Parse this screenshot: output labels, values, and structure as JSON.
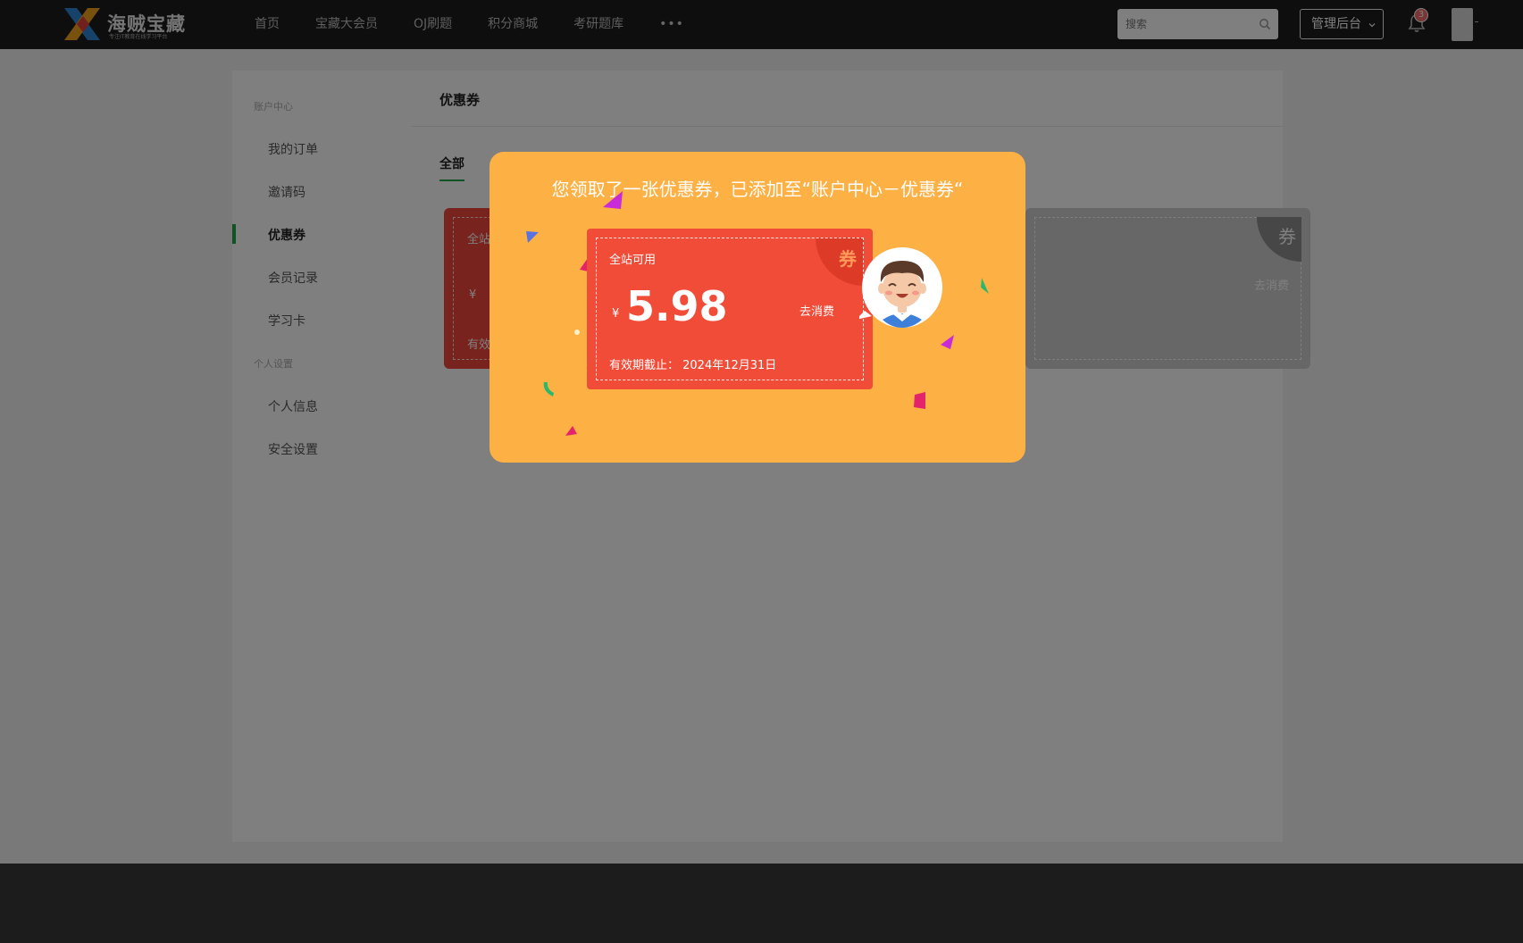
{
  "header": {
    "logo_title": "海贼宝藏",
    "logo_subtitle": "专注IT教育在线学习平台",
    "nav": [
      "首页",
      "宝藏大会员",
      "OJ刷题",
      "积分商城",
      "考研题库"
    ],
    "nav_more": "•••",
    "search_placeholder": "搜索",
    "admin_label": "管理后台",
    "notification_count": "3"
  },
  "sidebar": {
    "group_account": "账户中心",
    "account_items": [
      "我的订单",
      "邀请码",
      "优惠券",
      "会员记录",
      "学习卡"
    ],
    "group_personal": "个人设置",
    "personal_items": [
      "个人信息",
      "安全设置"
    ]
  },
  "main": {
    "title": "优惠券",
    "tab_all": "全部",
    "bg_red_scope": "全站",
    "bg_red_yen": "¥",
    "bg_red_exp": "有效",
    "bg_grey_corner": "券",
    "bg_grey_use": "去消费"
  },
  "dialog": {
    "message": "您领取了一张优惠券，已添加至“账户中心－优惠券“",
    "coupon": {
      "scope": "全站可用",
      "currency": "¥",
      "amount": "5.98",
      "use": "去消费",
      "corner": "券",
      "expiry": "有效期截止：  2024年12月31日"
    }
  }
}
